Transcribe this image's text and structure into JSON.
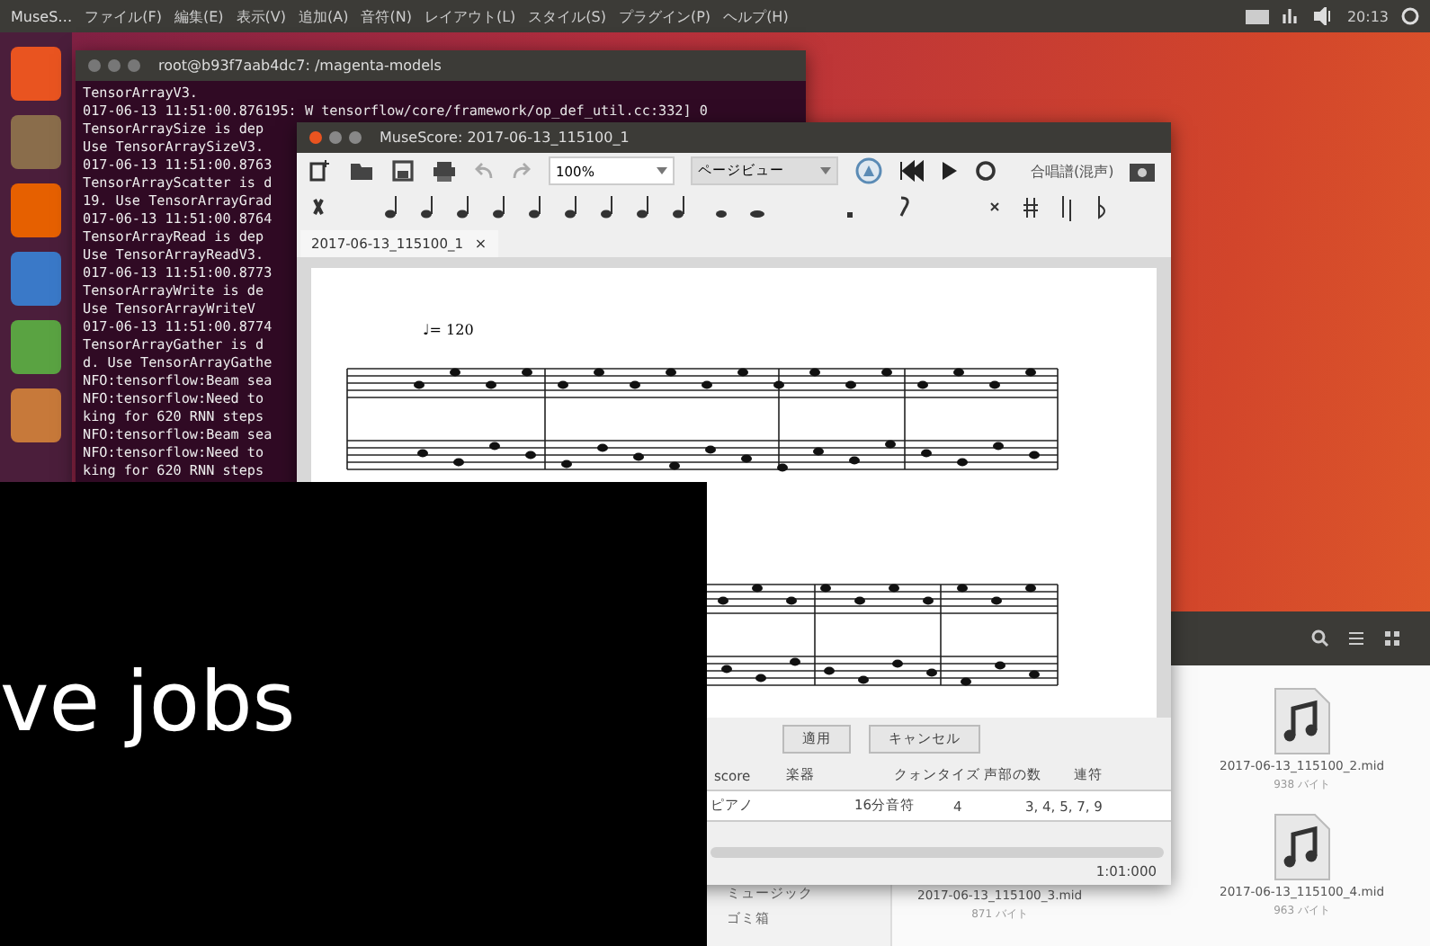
{
  "top_bar": {
    "app_name": "MuseS…",
    "menus": [
      "ファイル(F)",
      "編集(E)",
      "表示(V)",
      "追加(A)",
      "音符(N)",
      "レイアウト(L)",
      "スタイル(S)",
      "プラグイン(P)",
      "ヘルプ(H)"
    ],
    "clock": "20:13"
  },
  "terminal": {
    "title": "root@b93f7aab4dc7: /magenta-models",
    "lines": [
      "TensorArrayV3.",
      "017-06-13 11:51:00.876195: W tensorflow/core/framework/op_def_util.cc:332] 0",
      "TensorArraySize is dep",
      "Use TensorArraySizeV3.",
      "017-06-13 11:51:00.8763",
      "TensorArrayScatter is d",
      "19. Use TensorArrayGrad",
      "017-06-13 11:51:00.8764",
      "TensorArrayRead is dep",
      "Use TensorArrayReadV3.",
      "017-06-13 11:51:00.8773",
      "TensorArrayWrite is de",
      "Use TensorArrayWriteV",
      "017-06-13 11:51:00.8774",
      "TensorArrayGather is d",
      "d. Use TensorArrayGathe",
      "NFO:tensorflow:Beam sea",
      "NFO:tensorflow:Need to",
      "king for 620 RNN steps",
      "NFO:tensorflow:Beam sea",
      "NFO:tensorflow:Need to",
      "king for 620 RNN steps"
    ]
  },
  "musescore": {
    "title": "MuseScore: 2017-06-13_115100_1",
    "zoom": "100%",
    "view": "ページビュー",
    "instrument_set": "合唱譜(混声)",
    "tabs": [
      {
        "label": "2017-06-13_115100_1",
        "selected": true
      }
    ],
    "tab_close": "×",
    "tempo": "♩= 120",
    "buttons": [
      "適用",
      "キャンセル"
    ],
    "columns": [
      "score",
      "楽器",
      "クォンタイズ",
      "声部の数",
      "連符"
    ],
    "row": [
      "ピアノ",
      "16分音符",
      "4",
      "3, 4, 5, 7, 9"
    ],
    "status": "1:01:000"
  },
  "files": {
    "sidebar": [
      "ミュージック",
      "ゴミ箱"
    ],
    "items": [
      {
        "name": "2017-06-13_115100_2.mid",
        "size": "938 バイト"
      },
      {
        "name": "2017-06-13_115100_3.mid",
        "size": "871 バイト"
      },
      {
        "name": "2017-06-13_115100_4.mid",
        "size": "963 バイト"
      }
    ]
  },
  "caption": "ve jobs"
}
